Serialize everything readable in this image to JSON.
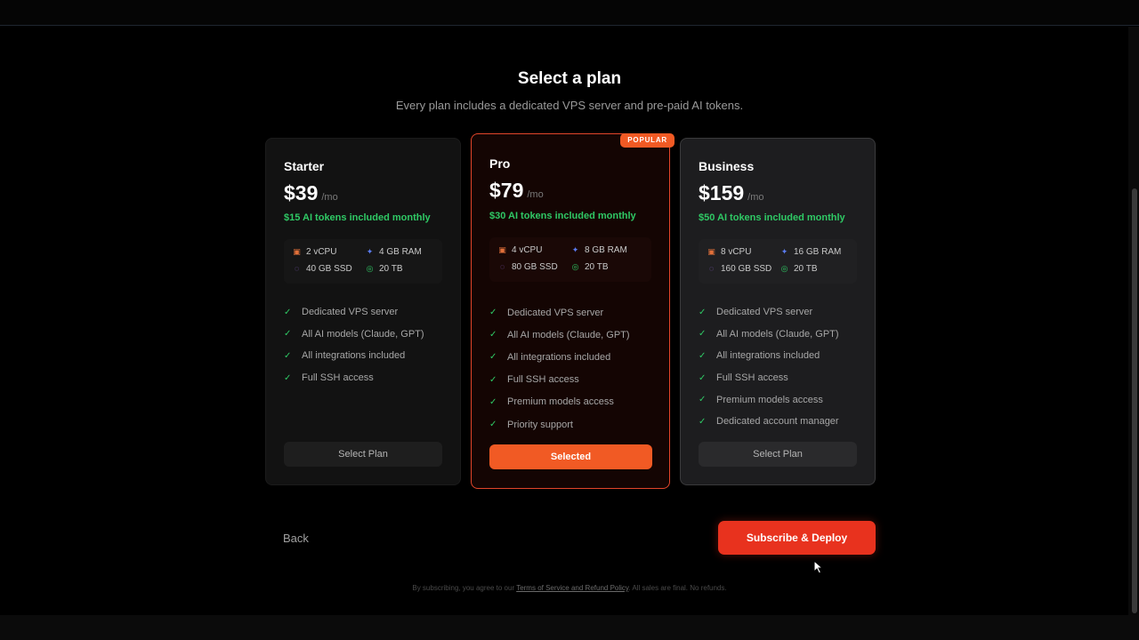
{
  "header": {
    "title": "Select a plan",
    "subtitle": "Every plan includes a dedicated VPS server and pre-paid AI tokens."
  },
  "plans": [
    {
      "name": "Starter",
      "price": "$39",
      "period": "/mo",
      "tokens": "$15 AI tokens included monthly",
      "specs": {
        "cpu": "2 vCPU",
        "ram": "4 GB RAM",
        "ssd": "40 GB SSD",
        "bandwidth": "20 TB"
      },
      "features": [
        "Dedicated VPS server",
        "All AI models (Claude, GPT)",
        "All integrations included",
        "Full SSH access"
      ],
      "button": "Select Plan"
    },
    {
      "name": "Pro",
      "badge": "POPULAR",
      "price": "$79",
      "period": "/mo",
      "tokens": "$30 AI tokens included monthly",
      "specs": {
        "cpu": "4 vCPU",
        "ram": "8 GB RAM",
        "ssd": "80 GB SSD",
        "bandwidth": "20 TB"
      },
      "features": [
        "Dedicated VPS server",
        "All AI models (Claude, GPT)",
        "All integrations included",
        "Full SSH access",
        "Premium models access",
        "Priority support"
      ],
      "button": "Selected"
    },
    {
      "name": "Business",
      "price": "$159",
      "period": "/mo",
      "tokens": "$50 AI tokens included monthly",
      "specs": {
        "cpu": "8 vCPU",
        "ram": "16 GB RAM",
        "ssd": "160 GB SSD",
        "bandwidth": "20 TB"
      },
      "features": [
        "Dedicated VPS server",
        "All AI models (Claude, GPT)",
        "All integrations included",
        "Full SSH access",
        "Premium models access",
        "Dedicated account manager"
      ],
      "button": "Select Plan"
    }
  ],
  "footer": {
    "back": "Back",
    "subscribe": "Subscribe & Deploy",
    "legal_prefix": "By subscribing, you agree to our",
    "legal_link": "Terms of Service and Refund Policy",
    "legal_suffix": ". All sales are final. No refunds."
  },
  "colors": {
    "accent": "#f15a24",
    "subscribe": "#e8321e",
    "token_green": "#2fc965",
    "background": "#000000"
  },
  "icons": {
    "cpu": "cpu-icon",
    "ram": "memory-icon",
    "ssd": "disk-icon",
    "bandwidth": "globe-icon",
    "feature": "check-icon"
  }
}
